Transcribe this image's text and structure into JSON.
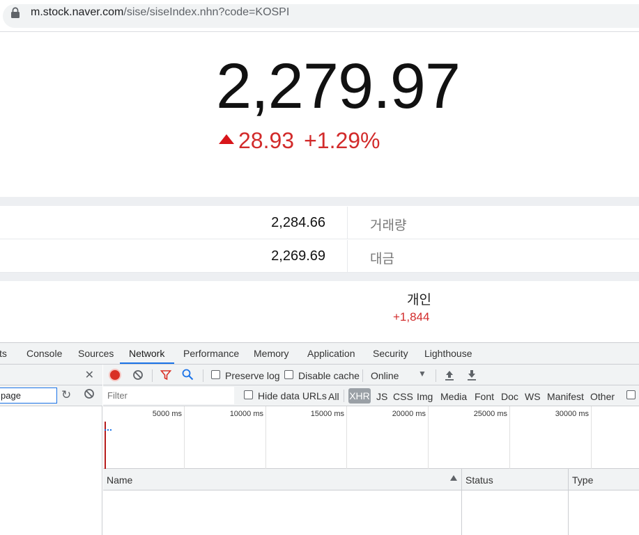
{
  "browser": {
    "url_host": "m.stock.naver.com",
    "url_path": "/sise/siseIndex.nhn?code=KOSPI"
  },
  "index": {
    "value": "2,279.97",
    "change": "28.93",
    "change_pct": "+1.29%",
    "direction": "up",
    "up_color": "#d22b2b"
  },
  "stats": [
    {
      "value": "2,284.66",
      "label": "거래량"
    },
    {
      "value": "2,269.69",
      "label": "대금"
    }
  ],
  "investor": {
    "label": "개인",
    "value": "+1,844"
  },
  "devtools": {
    "tabs": [
      "ts",
      "Console",
      "Sources",
      "Network",
      "Performance",
      "Memory",
      "Application",
      "Security",
      "Lighthouse"
    ],
    "active_tab": "Network",
    "left_pane": {
      "search_value": "page"
    },
    "toolbar": {
      "preserve_log": "Preserve log",
      "disable_cache": "Disable cache",
      "throttle": "Online"
    },
    "filter": {
      "placeholder": "Filter",
      "hide_data_urls": "Hide data URLs",
      "types": [
        "All",
        "XHR",
        "JS",
        "CSS",
        "Img",
        "Media",
        "Font",
        "Doc",
        "WS",
        "Manifest",
        "Other"
      ],
      "active_type": "XHR"
    },
    "timeline_ticks": [
      "5000 ms",
      "10000 ms",
      "15000 ms",
      "20000 ms",
      "25000 ms",
      "30000 ms"
    ],
    "columns": [
      "Name",
      "Status",
      "Type"
    ]
  }
}
